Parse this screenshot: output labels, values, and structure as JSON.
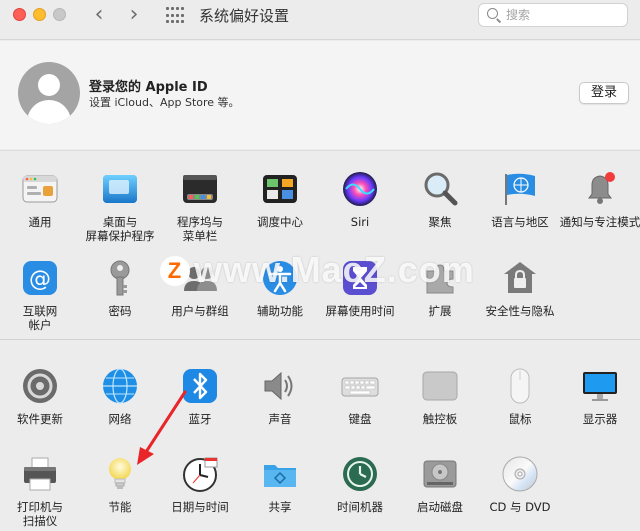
{
  "window": {
    "title": "系统偏好设置"
  },
  "search": {
    "placeholder": "搜索",
    "value": ""
  },
  "account": {
    "title": "登录您的 Apple ID",
    "subtitle": "设置 iCloud、App Store 等。",
    "login_label": "登录"
  },
  "row1": [
    {
      "label": "通用",
      "icon": "general-icon"
    },
    {
      "label": "桌面与\n屏幕保护程序",
      "icon": "desktop-icon"
    },
    {
      "label": "程序坞与\n菜单栏",
      "icon": "dock-icon"
    },
    {
      "label": "调度中心",
      "icon": "mission-control-icon"
    },
    {
      "label": "Siri",
      "icon": "siri-icon"
    },
    {
      "label": "聚焦",
      "icon": "spotlight-icon"
    },
    {
      "label": "语言与地区",
      "icon": "language-icon"
    },
    {
      "label": "通知与专注模式",
      "icon": "notification-icon"
    }
  ],
  "row2": [
    {
      "label": "互联网\n帐户",
      "icon": "internet-accounts-icon"
    },
    {
      "label": "密码",
      "icon": "password-icon"
    },
    {
      "label": "用户与群组",
      "icon": "users-icon"
    },
    {
      "label": "辅助功能",
      "icon": "accessibility-icon"
    },
    {
      "label": "屏幕使用时间",
      "icon": "screen-time-icon"
    },
    {
      "label": "扩展",
      "icon": "extensions-icon"
    },
    {
      "label": "安全性与隐私",
      "icon": "security-icon"
    }
  ],
  "row3": [
    {
      "label": "软件更新",
      "icon": "software-update-icon"
    },
    {
      "label": "网络",
      "icon": "network-icon"
    },
    {
      "label": "蓝牙",
      "icon": "bluetooth-icon"
    },
    {
      "label": "声音",
      "icon": "sound-icon"
    },
    {
      "label": "键盘",
      "icon": "keyboard-icon"
    },
    {
      "label": "触控板",
      "icon": "trackpad-icon"
    },
    {
      "label": "鼠标",
      "icon": "mouse-icon"
    },
    {
      "label": "显示器",
      "icon": "display-icon"
    }
  ],
  "row4": [
    {
      "label": "打印机与\n扫描仪",
      "icon": "printer-icon"
    },
    {
      "label": "节能",
      "icon": "energy-saver-icon"
    },
    {
      "label": "日期与时间",
      "icon": "date-time-icon"
    },
    {
      "label": "共享",
      "icon": "sharing-icon"
    },
    {
      "label": "时间机器",
      "icon": "time-machine-icon"
    },
    {
      "label": "启动磁盘",
      "icon": "startup-disk-icon"
    },
    {
      "label": "CD 与 DVD",
      "icon": "cd-dvd-icon"
    }
  ],
  "watermark": {
    "badge": "Z",
    "text": "www.MacZ.com"
  },
  "colors": {
    "arrow": "#e8262a",
    "accent": "#1e88e5"
  }
}
